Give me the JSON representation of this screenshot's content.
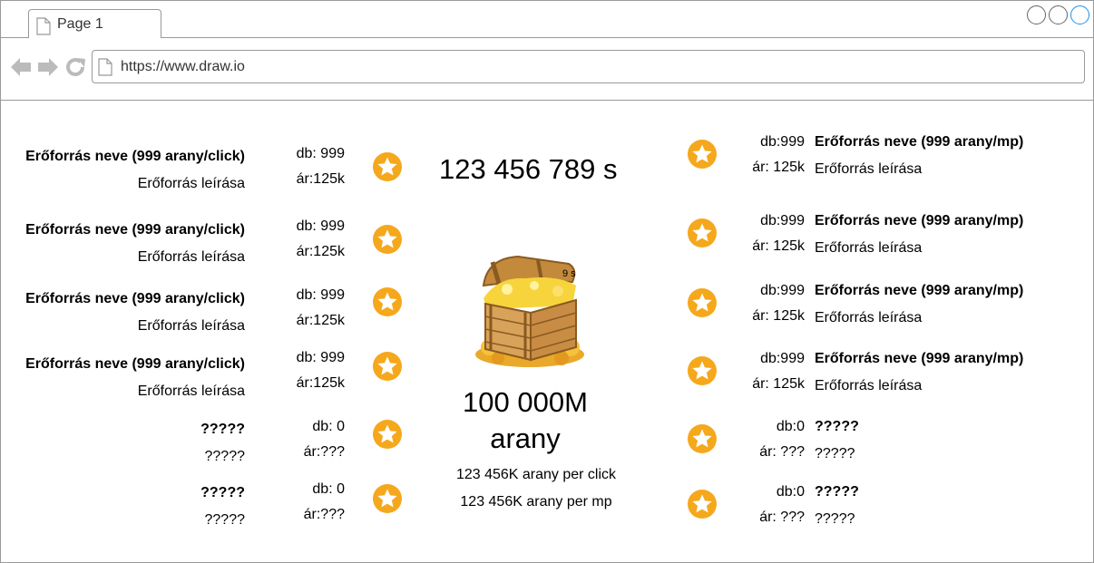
{
  "browser": {
    "tab_title": "Page 1",
    "url": "https://www.draw.io"
  },
  "left_resources": [
    {
      "name": "Erőforrás neve (999 arany/click)",
      "desc": "Erőforrás leírása",
      "db": "db: 999",
      "price": "ár:125k"
    },
    {
      "name": "Erőforrás neve (999 arany/click)",
      "desc": "Erőforrás leírása",
      "db": "db:  999",
      "price": "ár:125k"
    },
    {
      "name": "Erőforrás neve (999 arany/click)",
      "desc": "Erőforrás leírása",
      "db": "db: 999",
      "price": "ár:125k"
    },
    {
      "name": "Erőforrás neve (999 arany/click)",
      "desc": "Erőforrás leírása",
      "db": "db: 999",
      "price": "ár:125k"
    },
    {
      "name": "?????",
      "desc": "?????",
      "db": "db: 0",
      "price": "ár:???"
    },
    {
      "name": "?????",
      "desc": "?????",
      "db": "db: 0",
      "price": "ár:???"
    }
  ],
  "right_resources": [
    {
      "name": "Erőforrás neve (999 arany/mp)",
      "desc": "Erőforrás leírása",
      "db": "db:999",
      "price": "ár: 125k"
    },
    {
      "name": "Erőforrás neve (999 arany/mp)",
      "desc": "Erőforrás leírása",
      "db": "db:999",
      "price": "ár: 125k"
    },
    {
      "name": "Erőforrás neve (999 arany/mp)",
      "desc": "Erőforrás leírása",
      "db": "db:999",
      "price": "ár: 125k"
    },
    {
      "name": "Erőforrás neve (999 arany/mp)",
      "desc": "Erőforrás leírása",
      "db": "db:999",
      "price": "ár: 125k"
    },
    {
      "name": "?????",
      "desc": "?????",
      "db": "db:0",
      "price": "ár: ???"
    },
    {
      "name": "?????",
      "desc": "?????",
      "db": "db:0",
      "price": "ár: ???"
    }
  ],
  "center": {
    "timer": "123 456 789 s",
    "chest_overlay": "9 s",
    "gold_amount": "100 000M",
    "gold_unit": "arany",
    "per_click": "123 456K arany per click",
    "per_second": "123 456K arany per mp"
  },
  "colors": {
    "star_fill": "#f5a81c",
    "star_center": "#ffffff",
    "window_button_accent": "#1f8fe6"
  },
  "icons": {
    "resource_icon": "star-coin-icon",
    "chest": "treasure-chest-icon"
  }
}
